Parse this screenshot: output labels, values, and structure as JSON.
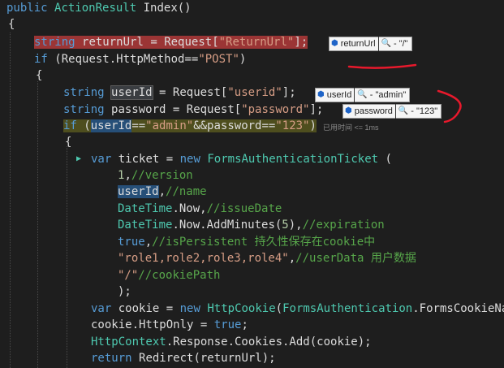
{
  "code": {
    "l0": [
      "public",
      "ActionResult",
      "Index()"
    ],
    "l1": "{",
    "l2": [
      "string",
      "returnUrl",
      "=",
      "Request[",
      "\"ReturnUrl\"",
      "];"
    ],
    "l3": [
      "if",
      "(Request.HttpMethod==",
      "\"POST\"",
      ")"
    ],
    "l4": "{",
    "l5": [
      "string",
      "userId",
      "=",
      "Request[",
      "\"userid\"",
      "];"
    ],
    "l6": [
      "string",
      "password",
      "=",
      "Request[",
      "\"password\"",
      "];"
    ],
    "l7": [
      "if",
      "(",
      "userId",
      "==",
      "\"admin\"",
      "&&password==",
      "\"123\"",
      ")"
    ],
    "l8": "{",
    "l9": [
      "var",
      "ticket",
      "=",
      "new",
      "FormsAuthenticationTicket",
      "("
    ],
    "l10": [
      "1",
      ",",
      "//version"
    ],
    "l11": [
      "userId",
      ",",
      "//name"
    ],
    "l12": [
      "DateTime",
      ".Now,",
      "//issueDate"
    ],
    "l13": [
      "DateTime",
      ".Now.AddMinutes(",
      "5",
      "),",
      "//expiration"
    ],
    "l14": [
      "true",
      ",",
      "//isPersistent 持久性保存在cookie中"
    ],
    "l15": [
      "\"role1,role2,role3,role4\"",
      ",",
      "//userData 用户数据"
    ],
    "l16": [
      "\"/\"",
      "//cookiePath"
    ],
    "l17": ");",
    "l18": [
      "var",
      "cookie",
      "=",
      "new",
      "HttpCookie",
      "(",
      "FormsAuthentication",
      ".FormsCookieNa"
    ],
    "l19": [
      "cookie.HttpOnly",
      "=",
      "true",
      ";"
    ],
    "l20": [
      "HttpContext",
      ".Response.Cookies.Add(",
      "cookie",
      ");"
    ],
    "l21": [
      "return",
      "Redirect(",
      "returnUrl",
      ");"
    ]
  },
  "tooltips": {
    "returnUrl": {
      "name": "returnUrl",
      "value": "- \"/\""
    },
    "userId": {
      "name": "userId",
      "value": "- \"admin\""
    },
    "password": {
      "name": "password",
      "value": "- \"123\""
    }
  },
  "elapsed": "已用时间 <= 1ms"
}
